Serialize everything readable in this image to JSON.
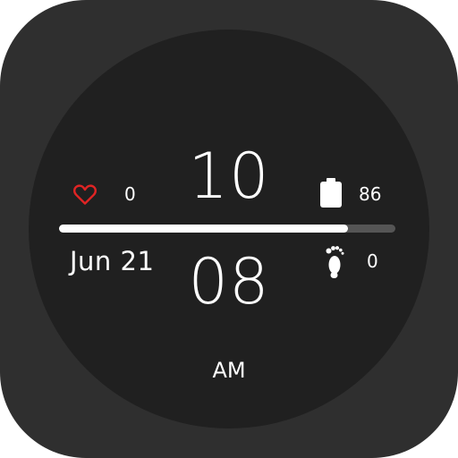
{
  "watch": {
    "time": {
      "hour": "10",
      "minute": "08",
      "period": "AM"
    },
    "date": "Jun 21",
    "heart_rate": {
      "value": "0",
      "icon": "heart-icon",
      "color": "#e02424"
    },
    "battery": {
      "value": "86",
      "icon": "battery-icon"
    },
    "steps": {
      "value": "0",
      "icon": "footprint-icon"
    },
    "progress": {
      "fraction": 0.86
    },
    "colors": {
      "case": "#2f2f2f",
      "face": "#202020",
      "text": "#ffffff",
      "track": "#555555"
    }
  }
}
